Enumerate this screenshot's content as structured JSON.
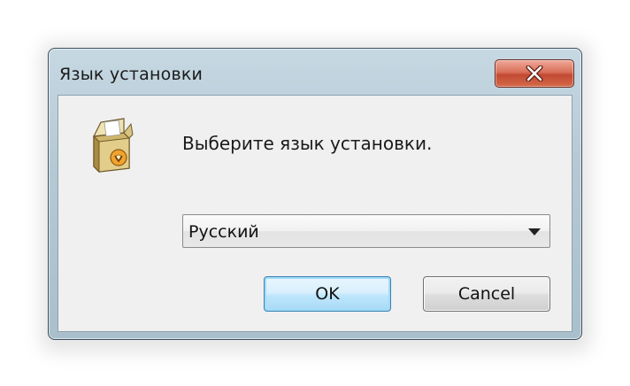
{
  "dialog": {
    "title": "Язык установки",
    "prompt": "Выберите язык установки.",
    "language_select": {
      "selected": "Русский"
    },
    "ok_label": "OK",
    "cancel_label": "Cancel",
    "icons": {
      "close": "close-icon",
      "installer": "installer-box-icon",
      "dropdown": "chevron-down-icon"
    }
  }
}
